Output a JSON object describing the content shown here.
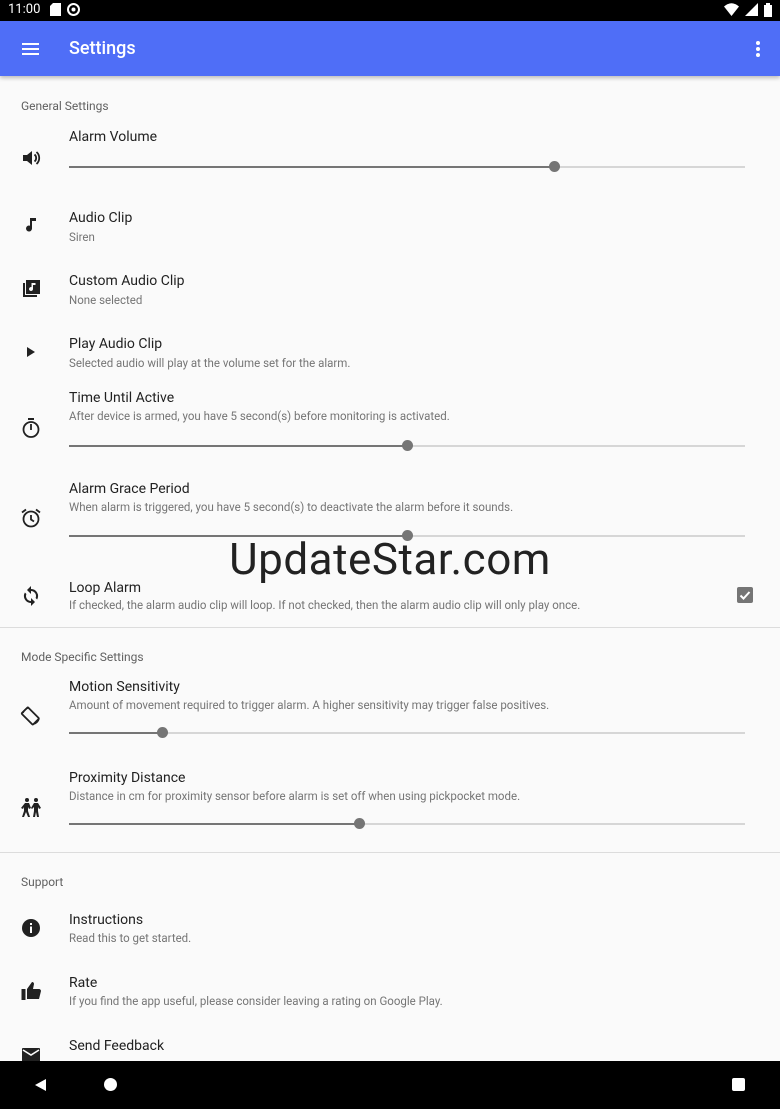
{
  "status_bar": {
    "time": "11:00"
  },
  "toolbar": {
    "title": "Settings"
  },
  "sections": {
    "general": "General Settings",
    "mode": "Mode Specific Settings",
    "support": "Support"
  },
  "prefs": {
    "alarm_volume": {
      "title": "Alarm Volume",
      "value": 0.717
    },
    "audio_clip": {
      "title": "Audio Clip",
      "summary": "Siren"
    },
    "custom_audio_clip": {
      "title": "Custom Audio Clip",
      "summary": "None selected"
    },
    "play_audio_clip": {
      "title": "Play Audio Clip",
      "summary": "Selected audio will play at the volume set for the alarm."
    },
    "time_until_active": {
      "title": "Time Until Active",
      "summary": "After device is armed, you have 5 second(s) before monitoring is activated.",
      "value": 0.5
    },
    "alarm_grace_period": {
      "title": "Alarm Grace Period",
      "summary": "When alarm is triggered, you have 5 second(s) to deactivate the alarm before it sounds.",
      "value": 0.5
    },
    "loop_alarm": {
      "title": "Loop Alarm",
      "summary": "If checked, the alarm audio clip will loop. If not checked, then the alarm audio clip will only play once.",
      "checked": true
    },
    "motion_sensitivity": {
      "title": "Motion Sensitivity",
      "summary": "Amount of movement required to trigger alarm. A higher sensitivity may trigger false positives.",
      "value": 0.137
    },
    "proximity_distance": {
      "title": "Proximity Distance",
      "summary": "Distance in cm for proximity sensor before alarm is set off when using pickpocket mode.",
      "value": 0.429
    },
    "instructions": {
      "title": "Instructions",
      "summary": "Read this to get started."
    },
    "rate": {
      "title": "Rate",
      "summary": "If you find the app useful, please consider leaving a rating on Google Play."
    },
    "send_feedback": {
      "title": "Send Feedback"
    }
  },
  "watermark": "UpdateStar.com",
  "colors": {
    "toolbar": "#4f6ef7",
    "accent": "#757575"
  }
}
